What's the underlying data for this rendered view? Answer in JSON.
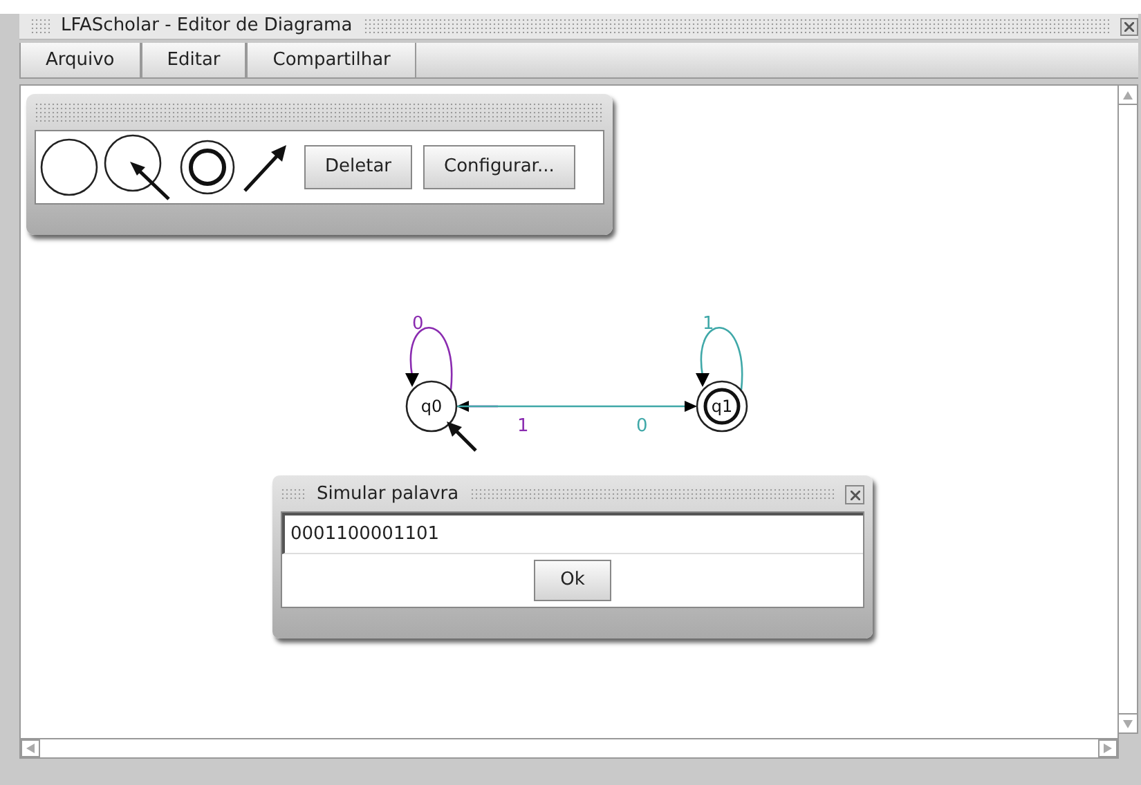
{
  "window": {
    "title": "LFAScholar - Editor de Diagrama"
  },
  "menu": [
    {
      "label": "Arquivo"
    },
    {
      "label": "Editar"
    },
    {
      "label": "Compartilhar"
    }
  ],
  "palette": {
    "tools": [
      {
        "kind": "state"
      },
      {
        "kind": "initial"
      },
      {
        "kind": "accepting"
      },
      {
        "kind": "transition"
      }
    ],
    "buttons": [
      "Deletar",
      "Configurar..."
    ]
  },
  "diagram": {
    "states": [
      {
        "label": "q0",
        "initial": true,
        "accepting": false
      },
      {
        "label": "q1",
        "initial": false,
        "accepting": true
      }
    ],
    "transitions": [
      {
        "kind": "loop_first",
        "label": "0",
        "color": "#8a2bb0"
      },
      {
        "kind": "loop_second",
        "label": "1",
        "color": "#3fa8a8"
      },
      {
        "kind": "second_to_first",
        "label": "1",
        "color": "#8a2bb0"
      },
      {
        "kind": "first_to_second",
        "label": "0",
        "color": "#3fa8a8"
      }
    ]
  },
  "dialog": {
    "title": "Simular palavra",
    "value": "0001100001101",
    "button": "Ok"
  }
}
